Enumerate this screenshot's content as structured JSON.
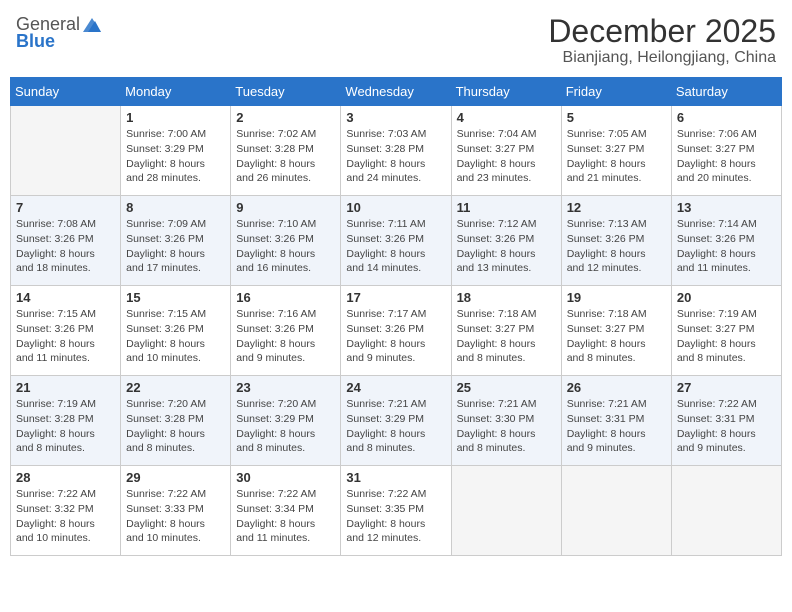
{
  "header": {
    "logo_general": "General",
    "logo_blue": "Blue",
    "month_title": "December 2025",
    "location": "Bianjiang, Heilongjiang, China"
  },
  "weekdays": [
    "Sunday",
    "Monday",
    "Tuesday",
    "Wednesday",
    "Thursday",
    "Friday",
    "Saturday"
  ],
  "weeks": [
    [
      {
        "day": "",
        "info": ""
      },
      {
        "day": "1",
        "info": "Sunrise: 7:00 AM\nSunset: 3:29 PM\nDaylight: 8 hours\nand 28 minutes."
      },
      {
        "day": "2",
        "info": "Sunrise: 7:02 AM\nSunset: 3:28 PM\nDaylight: 8 hours\nand 26 minutes."
      },
      {
        "day": "3",
        "info": "Sunrise: 7:03 AM\nSunset: 3:28 PM\nDaylight: 8 hours\nand 24 minutes."
      },
      {
        "day": "4",
        "info": "Sunrise: 7:04 AM\nSunset: 3:27 PM\nDaylight: 8 hours\nand 23 minutes."
      },
      {
        "day": "5",
        "info": "Sunrise: 7:05 AM\nSunset: 3:27 PM\nDaylight: 8 hours\nand 21 minutes."
      },
      {
        "day": "6",
        "info": "Sunrise: 7:06 AM\nSunset: 3:27 PM\nDaylight: 8 hours\nand 20 minutes."
      }
    ],
    [
      {
        "day": "7",
        "info": "Sunrise: 7:08 AM\nSunset: 3:26 PM\nDaylight: 8 hours\nand 18 minutes."
      },
      {
        "day": "8",
        "info": "Sunrise: 7:09 AM\nSunset: 3:26 PM\nDaylight: 8 hours\nand 17 minutes."
      },
      {
        "day": "9",
        "info": "Sunrise: 7:10 AM\nSunset: 3:26 PM\nDaylight: 8 hours\nand 16 minutes."
      },
      {
        "day": "10",
        "info": "Sunrise: 7:11 AM\nSunset: 3:26 PM\nDaylight: 8 hours\nand 14 minutes."
      },
      {
        "day": "11",
        "info": "Sunrise: 7:12 AM\nSunset: 3:26 PM\nDaylight: 8 hours\nand 13 minutes."
      },
      {
        "day": "12",
        "info": "Sunrise: 7:13 AM\nSunset: 3:26 PM\nDaylight: 8 hours\nand 12 minutes."
      },
      {
        "day": "13",
        "info": "Sunrise: 7:14 AM\nSunset: 3:26 PM\nDaylight: 8 hours\nand 11 minutes."
      }
    ],
    [
      {
        "day": "14",
        "info": "Sunrise: 7:15 AM\nSunset: 3:26 PM\nDaylight: 8 hours\nand 11 minutes."
      },
      {
        "day": "15",
        "info": "Sunrise: 7:15 AM\nSunset: 3:26 PM\nDaylight: 8 hours\nand 10 minutes."
      },
      {
        "day": "16",
        "info": "Sunrise: 7:16 AM\nSunset: 3:26 PM\nDaylight: 8 hours\nand 9 minutes."
      },
      {
        "day": "17",
        "info": "Sunrise: 7:17 AM\nSunset: 3:26 PM\nDaylight: 8 hours\nand 9 minutes."
      },
      {
        "day": "18",
        "info": "Sunrise: 7:18 AM\nSunset: 3:27 PM\nDaylight: 8 hours\nand 8 minutes."
      },
      {
        "day": "19",
        "info": "Sunrise: 7:18 AM\nSunset: 3:27 PM\nDaylight: 8 hours\nand 8 minutes."
      },
      {
        "day": "20",
        "info": "Sunrise: 7:19 AM\nSunset: 3:27 PM\nDaylight: 8 hours\nand 8 minutes."
      }
    ],
    [
      {
        "day": "21",
        "info": "Sunrise: 7:19 AM\nSunset: 3:28 PM\nDaylight: 8 hours\nand 8 minutes."
      },
      {
        "day": "22",
        "info": "Sunrise: 7:20 AM\nSunset: 3:28 PM\nDaylight: 8 hours\nand 8 minutes."
      },
      {
        "day": "23",
        "info": "Sunrise: 7:20 AM\nSunset: 3:29 PM\nDaylight: 8 hours\nand 8 minutes."
      },
      {
        "day": "24",
        "info": "Sunrise: 7:21 AM\nSunset: 3:29 PM\nDaylight: 8 hours\nand 8 minutes."
      },
      {
        "day": "25",
        "info": "Sunrise: 7:21 AM\nSunset: 3:30 PM\nDaylight: 8 hours\nand 8 minutes."
      },
      {
        "day": "26",
        "info": "Sunrise: 7:21 AM\nSunset: 3:31 PM\nDaylight: 8 hours\nand 9 minutes."
      },
      {
        "day": "27",
        "info": "Sunrise: 7:22 AM\nSunset: 3:31 PM\nDaylight: 8 hours\nand 9 minutes."
      }
    ],
    [
      {
        "day": "28",
        "info": "Sunrise: 7:22 AM\nSunset: 3:32 PM\nDaylight: 8 hours\nand 10 minutes."
      },
      {
        "day": "29",
        "info": "Sunrise: 7:22 AM\nSunset: 3:33 PM\nDaylight: 8 hours\nand 10 minutes."
      },
      {
        "day": "30",
        "info": "Sunrise: 7:22 AM\nSunset: 3:34 PM\nDaylight: 8 hours\nand 11 minutes."
      },
      {
        "day": "31",
        "info": "Sunrise: 7:22 AM\nSunset: 3:35 PM\nDaylight: 8 hours\nand 12 minutes."
      },
      {
        "day": "",
        "info": ""
      },
      {
        "day": "",
        "info": ""
      },
      {
        "day": "",
        "info": ""
      }
    ]
  ],
  "row_shading": [
    false,
    true,
    false,
    true,
    false
  ]
}
